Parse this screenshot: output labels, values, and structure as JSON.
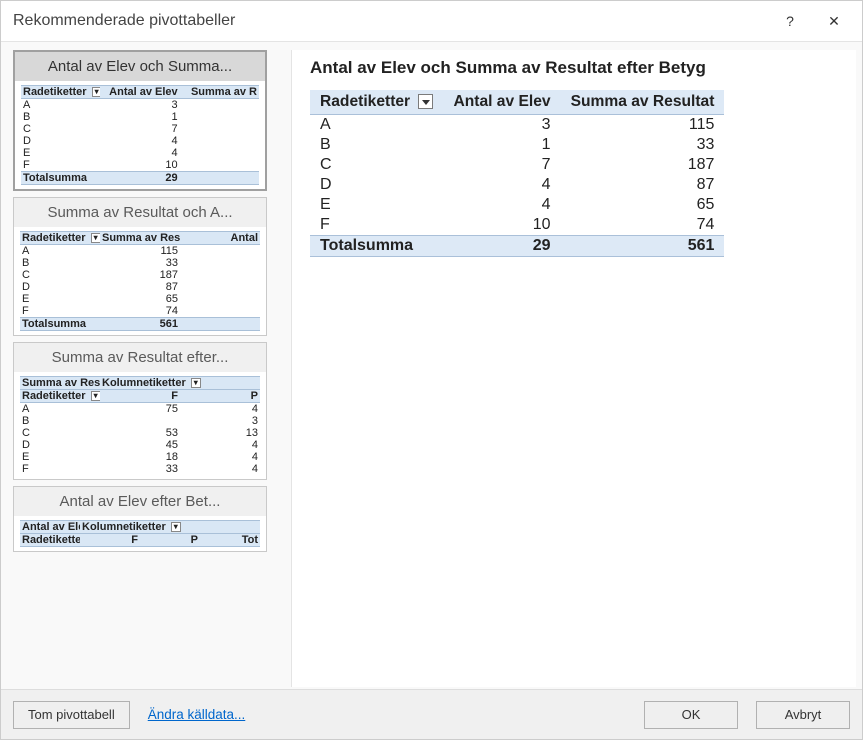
{
  "dialog": {
    "title": "Rekommenderade pivottabeller",
    "help_icon": "?",
    "close_icon": "✕"
  },
  "recommendations": [
    {
      "title": "Antal av Elev och Summa...",
      "selected": true,
      "headers": [
        "Radetiketter",
        "Antal av Elev",
        "Summa av R"
      ],
      "rows": [
        {
          "label": "A",
          "c1": "3",
          "c2": ""
        },
        {
          "label": "B",
          "c1": "1",
          "c2": ""
        },
        {
          "label": "C",
          "c1": "7",
          "c2": ""
        },
        {
          "label": "D",
          "c1": "4",
          "c2": ""
        },
        {
          "label": "E",
          "c1": "4",
          "c2": ""
        },
        {
          "label": "F",
          "c1": "10",
          "c2": ""
        }
      ],
      "total": {
        "label": "Totalsumma",
        "c1": "29",
        "c2": ""
      }
    },
    {
      "title": "Summa av Resultat och A...",
      "selected": false,
      "headers": [
        "Radetiketter",
        "Summa av Resultat",
        "Antal"
      ],
      "rows": [
        {
          "label": "A",
          "c1": "115",
          "c2": ""
        },
        {
          "label": "B",
          "c1": "33",
          "c2": ""
        },
        {
          "label": "C",
          "c1": "187",
          "c2": ""
        },
        {
          "label": "D",
          "c1": "87",
          "c2": ""
        },
        {
          "label": "E",
          "c1": "65",
          "c2": ""
        },
        {
          "label": "F",
          "c1": "74",
          "c2": ""
        }
      ],
      "total": {
        "label": "Totalsumma",
        "c1": "561",
        "c2": ""
      }
    },
    {
      "title": "Summa av Resultat efter...",
      "selected": false,
      "leading_header": {
        "left": "Summa av Resultat",
        "right": "Kolumnetiketter"
      },
      "headers": [
        "Radetiketter",
        "F",
        "P"
      ],
      "rows": [
        {
          "label": "A",
          "c1": "75",
          "c2": "4"
        },
        {
          "label": "B",
          "c1": "",
          "c2": "3"
        },
        {
          "label": "C",
          "c1": "53",
          "c2": "13"
        },
        {
          "label": "D",
          "c1": "45",
          "c2": "4"
        },
        {
          "label": "E",
          "c1": "18",
          "c2": "4"
        },
        {
          "label": "F",
          "c1": "33",
          "c2": "4"
        }
      ]
    },
    {
      "title": "Antal av Elev efter Bet...",
      "selected": false,
      "leading_header": {
        "left": "Antal av Elev",
        "right": "Kolumnetiketter"
      },
      "headers": [
        "Radetiketter",
        "F",
        "P",
        "Tot"
      ]
    }
  ],
  "preview": {
    "title": "Antal av Elev och Summa av Resultat efter Betyg",
    "columns": [
      "Radetiketter",
      "Antal av Elev",
      "Summa av Resultat"
    ],
    "rows": [
      {
        "label": "A",
        "count": "3",
        "sum": "115"
      },
      {
        "label": "B",
        "count": "1",
        "sum": "33"
      },
      {
        "label": "C",
        "count": "7",
        "sum": "187"
      },
      {
        "label": "D",
        "count": "4",
        "sum": "87"
      },
      {
        "label": "E",
        "count": "4",
        "sum": "65"
      },
      {
        "label": "F",
        "count": "10",
        "sum": "74"
      }
    ],
    "total": {
      "label": "Totalsumma",
      "count": "29",
      "sum": "561"
    }
  },
  "footer": {
    "blank_pivot": "Tom pivottabell",
    "change_source": "Ändra källdata...",
    "ok": "OK",
    "cancel": "Avbryt"
  }
}
